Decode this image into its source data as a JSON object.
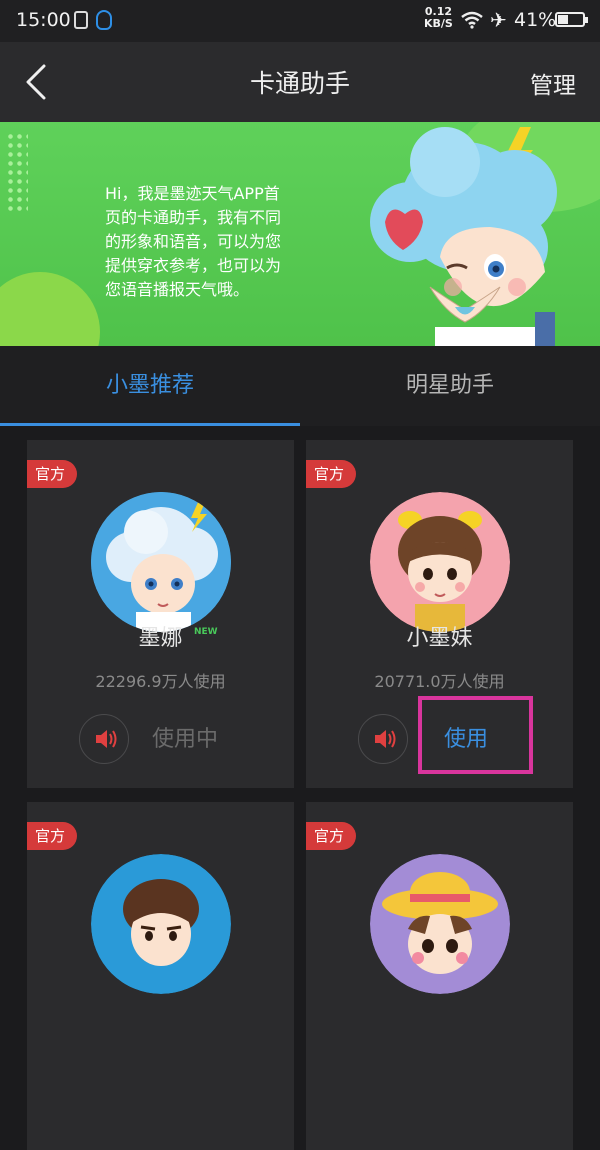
{
  "status_bar": {
    "time": "15:00",
    "net_speed_value": "0.12",
    "net_speed_unit": "KB/S",
    "battery": "41%",
    "icons": [
      "vibrate-icon",
      "qq-icon",
      "wifi-icon",
      "airplane-icon",
      "battery-icon"
    ]
  },
  "header": {
    "title": "卡通助手",
    "manage": "管理"
  },
  "banner": {
    "line1": "Hi，我是墨迹天气APP首",
    "line2": "页的卡通助手，我有不同",
    "line3": "的形象和语音，可以为您",
    "line4": "提供穿衣参考，也可以为",
    "line5": "您语音播报天气哦。"
  },
  "tabs": [
    {
      "label": "小墨推荐",
      "active": true
    },
    {
      "label": "明星助手",
      "active": false
    }
  ],
  "cards": [
    {
      "badge": "官方",
      "name": "墨娜",
      "new_tag": "NEW",
      "users": "22296.9万人使用",
      "action": "使用中",
      "action_state": "in-use"
    },
    {
      "badge": "官方",
      "name": "小墨妹",
      "users": "20771.0万人使用",
      "action": "使用",
      "action_state": "available"
    },
    {
      "badge": "官方"
    },
    {
      "badge": "官方"
    }
  ],
  "colors": {
    "accent": "#3a8fe0",
    "badge_red": "#d53a3a",
    "highlight_pink": "#d9359d",
    "banner_green": "#5fd15a"
  }
}
